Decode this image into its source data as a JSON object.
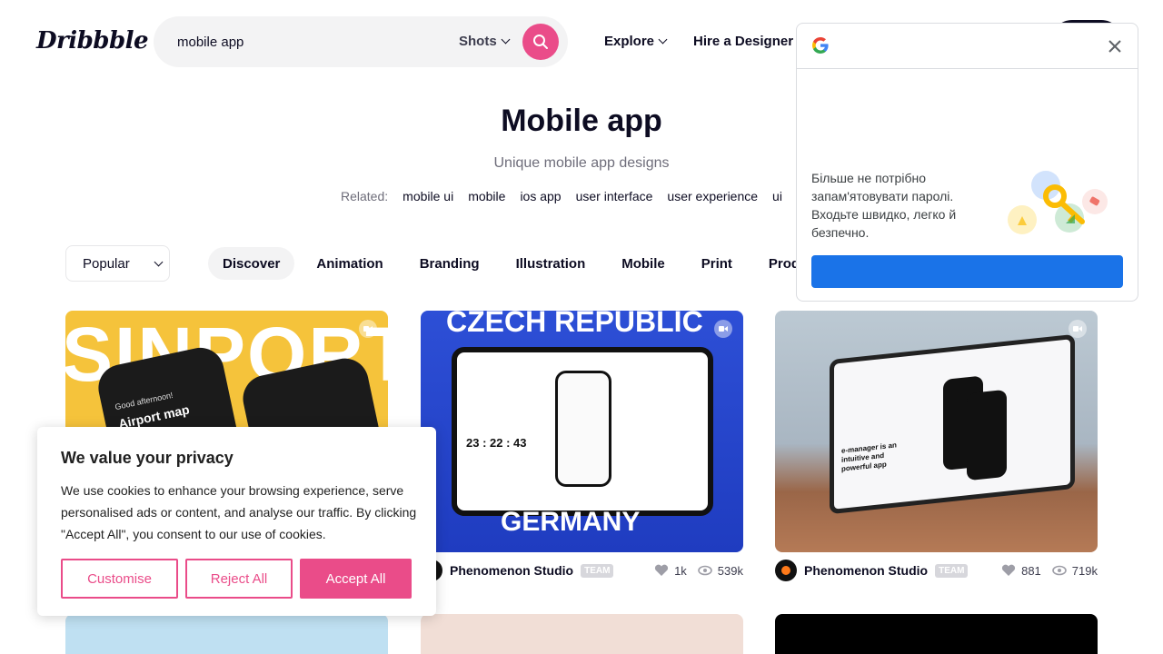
{
  "header": {
    "logo_text": "Dribbble",
    "search": {
      "value": "mobile app",
      "scope": "Shots"
    },
    "nav": [
      {
        "label": "Explore"
      },
      {
        "label": "Hire a Designer"
      }
    ]
  },
  "hero": {
    "title": "Mobile app",
    "subtitle": "Unique mobile app designs",
    "related_label": "Related:",
    "related_tags": [
      "mobile ui",
      "mobile",
      "ios app",
      "user interface",
      "user experience",
      "ui"
    ]
  },
  "filters": {
    "sort": "Popular",
    "categories": [
      "Discover",
      "Animation",
      "Branding",
      "Illustration",
      "Mobile",
      "Print",
      "Product"
    ]
  },
  "shots": [
    {
      "author": "",
      "badge": "",
      "likes": "",
      "views": ""
    },
    {
      "author": "Phenomenon Studio",
      "badge": "TEAM",
      "likes": "1k",
      "views": "539k"
    },
    {
      "author": "Phenomenon Studio",
      "badge": "TEAM",
      "likes": "881",
      "views": "719k"
    }
  ],
  "shot_text": {
    "s1_big": "SINPORT",
    "s1_greeting": "Good afternoon!",
    "s1_card": "Airport map",
    "s2_top": "CZECH REPUBLIC",
    "s2_bottom": "GERMANY",
    "s2_timer": "23 : 22 : 43",
    "s3_headline": "e-manager is an intuitive and powerful app"
  },
  "cookie": {
    "title": "We value your privacy",
    "body": "We use cookies to enhance your browsing experience, serve personalised ads or content, and analyse our traffic. By clicking \"Accept All\", you consent to our use of cookies.",
    "customise": "Customise",
    "reject": "Reject All",
    "accept": "Accept All"
  },
  "google_popup": {
    "message": "Більше не потрібно запам'ятовувати паролі. Входьте швидко, легко й безпечно."
  },
  "colors": {
    "brand_pink": "#ea4c89",
    "google_blue": "#1a73e8"
  }
}
